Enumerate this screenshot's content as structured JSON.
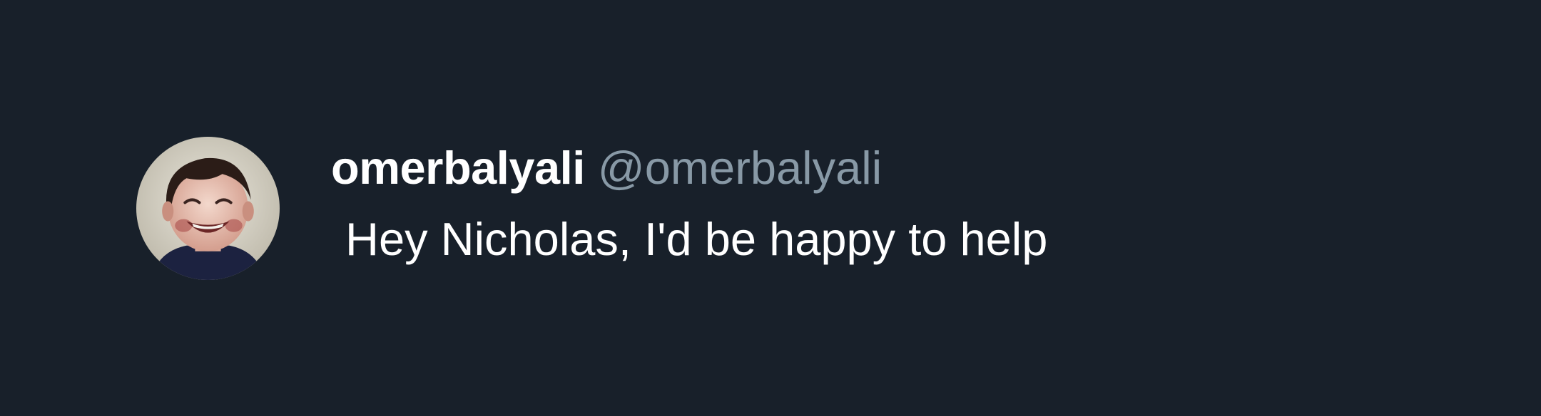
{
  "tweet": {
    "display_name": "omerbalyali",
    "handle": "@omerbalyali",
    "text": "Hey Nicholas, I'd be happy to help"
  },
  "avatar": {
    "icon": "profile-photo-avatar"
  },
  "colors": {
    "background": "#18202a",
    "name": "#ffffff",
    "handle": "#8899a6",
    "text": "#ffffff"
  }
}
